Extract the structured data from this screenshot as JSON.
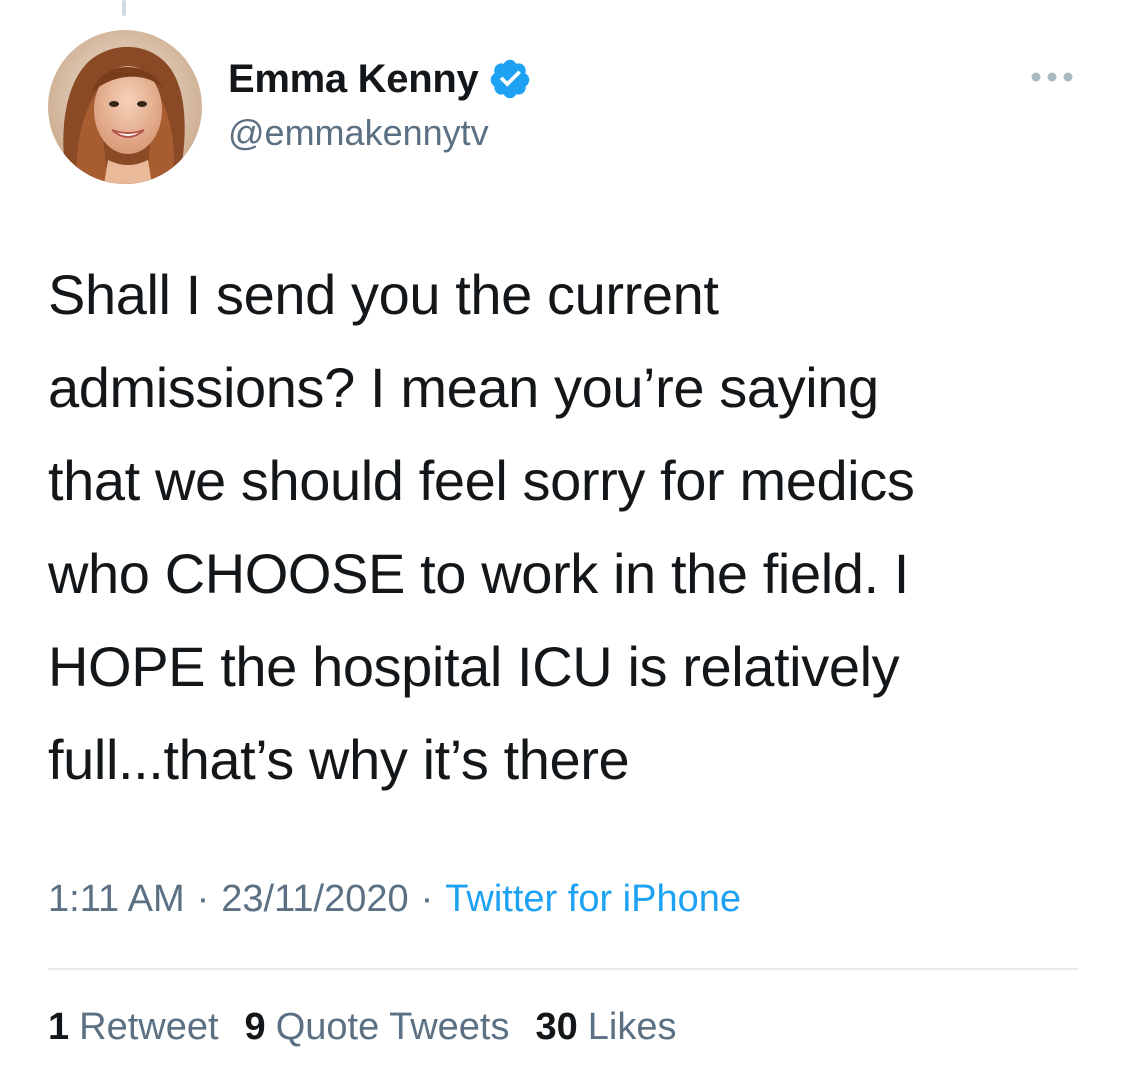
{
  "author": {
    "display_name": "Emma Kenny",
    "handle": "@emmakennytv",
    "verified_icon": "verified-badge-icon",
    "avatar": "profile-photo"
  },
  "more_icon": "more-options-icon",
  "tweet": {
    "text": "Shall I send you the current\nadmissions? I mean you’re saying\nthat we should feel sorry for medics\nwho CHOOSE to work in the field. I\nHOPE the hospital ICU is relatively\nfull...that’s why it’s there"
  },
  "meta": {
    "time": "1:11 AM",
    "separator": "·",
    "date": "23/11/2020",
    "source": "Twitter for iPhone"
  },
  "stats": {
    "retweets": {
      "count": "1",
      "label": "Retweet"
    },
    "quotes": {
      "count": "9",
      "label": "Quote Tweets"
    },
    "likes": {
      "count": "30",
      "label": "Likes"
    }
  },
  "colors": {
    "accent": "#1da1f2",
    "secondary_text": "#5b7083",
    "primary_text": "#14171a",
    "divider": "#e6ecf0"
  }
}
